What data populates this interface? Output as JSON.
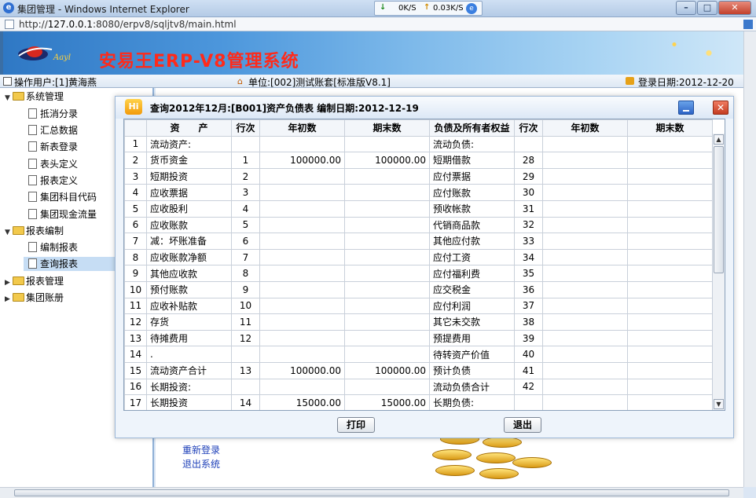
{
  "window": {
    "title": "集团管理 - Windows Internet Explorer",
    "download_speed": "0K/S",
    "upload_speed": "0.03K/S",
    "url_prefix": "http://",
    "url_host": "127.0.0.1",
    "url_rest": ":8080/erpv8/sqljtv8/main.html"
  },
  "banner": {
    "logo_text": "Aayl",
    "system_title": "安易王ERP-V8管理系统"
  },
  "info": {
    "user": "操作用户:[1]黄海燕",
    "unit": "单位:[002]测试账套[标准版V8.1]",
    "login_date": "登录日期:2012-12-20"
  },
  "sidebar": {
    "groups": [
      {
        "label": "系统管理",
        "expanded": true
      },
      {
        "label": "报表编制",
        "expanded": true
      },
      {
        "label": "报表管理",
        "expanded": false
      },
      {
        "label": "集团账册",
        "expanded": false
      }
    ],
    "system_items": [
      "抵消分录",
      "汇总数据",
      "新表登录",
      "表头定义",
      "报表定义",
      "集团科目代码",
      "集团现金流量"
    ],
    "report_items": [
      "编制报表",
      "查询报表"
    ],
    "selected": "查询报表"
  },
  "main": {
    "relogin": "重新登录",
    "exit_system": "退出系统"
  },
  "modal": {
    "title": "查询2012年12月:[B001]资产负债表 编制日期:2012-12-19",
    "headers": [
      "资　　产",
      "行次",
      "年初数",
      "期末数",
      "负债及所有者权益",
      "行次",
      "年初数",
      "期末数"
    ],
    "rows": [
      {
        "n": "1",
        "a": "流动资产:",
        "al": "",
        "ay": "",
        "ae": "",
        "l": "流动负债:",
        "ll": "",
        "ly": "",
        "le": "",
        "ai": 0,
        "li": 0
      },
      {
        "n": "2",
        "a": "货币资金",
        "al": "1",
        "ay": "100000.00",
        "ae": "100000.00",
        "l": "短期借款",
        "ll": "28",
        "ly": "",
        "le": "",
        "ai": 1,
        "li": 1
      },
      {
        "n": "3",
        "a": "短期投资",
        "al": "2",
        "ay": "",
        "ae": "",
        "l": "应付票据",
        "ll": "29",
        "ly": "",
        "le": "",
        "ai": 1,
        "li": 1
      },
      {
        "n": "4",
        "a": "应收票据",
        "al": "3",
        "ay": "",
        "ae": "",
        "l": "应付账款",
        "ll": "30",
        "ly": "",
        "le": "",
        "ai": 1,
        "li": 1
      },
      {
        "n": "5",
        "a": "应收股利",
        "al": "4",
        "ay": "",
        "ae": "",
        "l": "预收帐款",
        "ll": "31",
        "ly": "",
        "le": "",
        "ai": 1,
        "li": 1
      },
      {
        "n": "6",
        "a": "应收账款",
        "al": "5",
        "ay": "",
        "ae": "",
        "l": "代销商品款",
        "ll": "32",
        "ly": "",
        "le": "",
        "ai": 1,
        "li": 1
      },
      {
        "n": "7",
        "a": "减：坏账准备",
        "al": "6",
        "ay": "",
        "ae": "",
        "l": "其他应付款",
        "ll": "33",
        "ly": "",
        "le": "",
        "ai": 2,
        "li": 1
      },
      {
        "n": "8",
        "a": "应收账款净额",
        "al": "7",
        "ay": "",
        "ae": "",
        "l": "应付工资",
        "ll": "34",
        "ly": "",
        "le": "",
        "ai": 1,
        "li": 1
      },
      {
        "n": "9",
        "a": "其他应收款",
        "al": "8",
        "ay": "",
        "ae": "",
        "l": "应付福利费",
        "ll": "35",
        "ly": "",
        "le": "",
        "ai": 1,
        "li": 1
      },
      {
        "n": "10",
        "a": "预付账款",
        "al": "9",
        "ay": "",
        "ae": "",
        "l": "应交税金",
        "ll": "36",
        "ly": "",
        "le": "",
        "ai": 1,
        "li": 1
      },
      {
        "n": "11",
        "a": "应收补贴款",
        "al": "10",
        "ay": "",
        "ae": "",
        "l": "应付利润",
        "ll": "37",
        "ly": "",
        "le": "",
        "ai": 1,
        "li": 1
      },
      {
        "n": "12",
        "a": "存货",
        "al": "11",
        "ay": "",
        "ae": "",
        "l": "其它未交款",
        "ll": "38",
        "ly": "",
        "le": "",
        "ai": 1,
        "li": 1
      },
      {
        "n": "13",
        "a": "待摊费用",
        "al": "12",
        "ay": "",
        "ae": "",
        "l": "预提费用",
        "ll": "39",
        "ly": "",
        "le": "",
        "ai": 1,
        "li": 1
      },
      {
        "n": "14",
        "a": ".",
        "al": "",
        "ay": "",
        "ae": "",
        "l": "待转资产价值",
        "ll": "40",
        "ly": "",
        "le": "",
        "ai": 0,
        "li": 1
      },
      {
        "n": "15",
        "a": "流动资产合计",
        "al": "13",
        "ay": "100000.00",
        "ae": "100000.00",
        "l": "预计负债",
        "ll": "41",
        "ly": "",
        "le": "",
        "ai": 0,
        "li": 1
      },
      {
        "n": "16",
        "a": "长期投资:",
        "al": "",
        "ay": "",
        "ae": "",
        "l": "流动负债合计",
        "ll": "42",
        "ly": "",
        "le": "",
        "ai": 0,
        "li": 0
      },
      {
        "n": "17",
        "a": "长期投资",
        "al": "14",
        "ay": "15000.00",
        "ae": "15000.00",
        "l": "长期负债:",
        "ll": "",
        "ly": "",
        "le": "",
        "ai": 1,
        "li": 0
      }
    ],
    "print_label": "打印",
    "exit_label": "退出"
  },
  "colors": {
    "title_red": "#ff2a1a",
    "selected_bg": "#c6ddf4",
    "link_blue": "#1d3fb8"
  }
}
